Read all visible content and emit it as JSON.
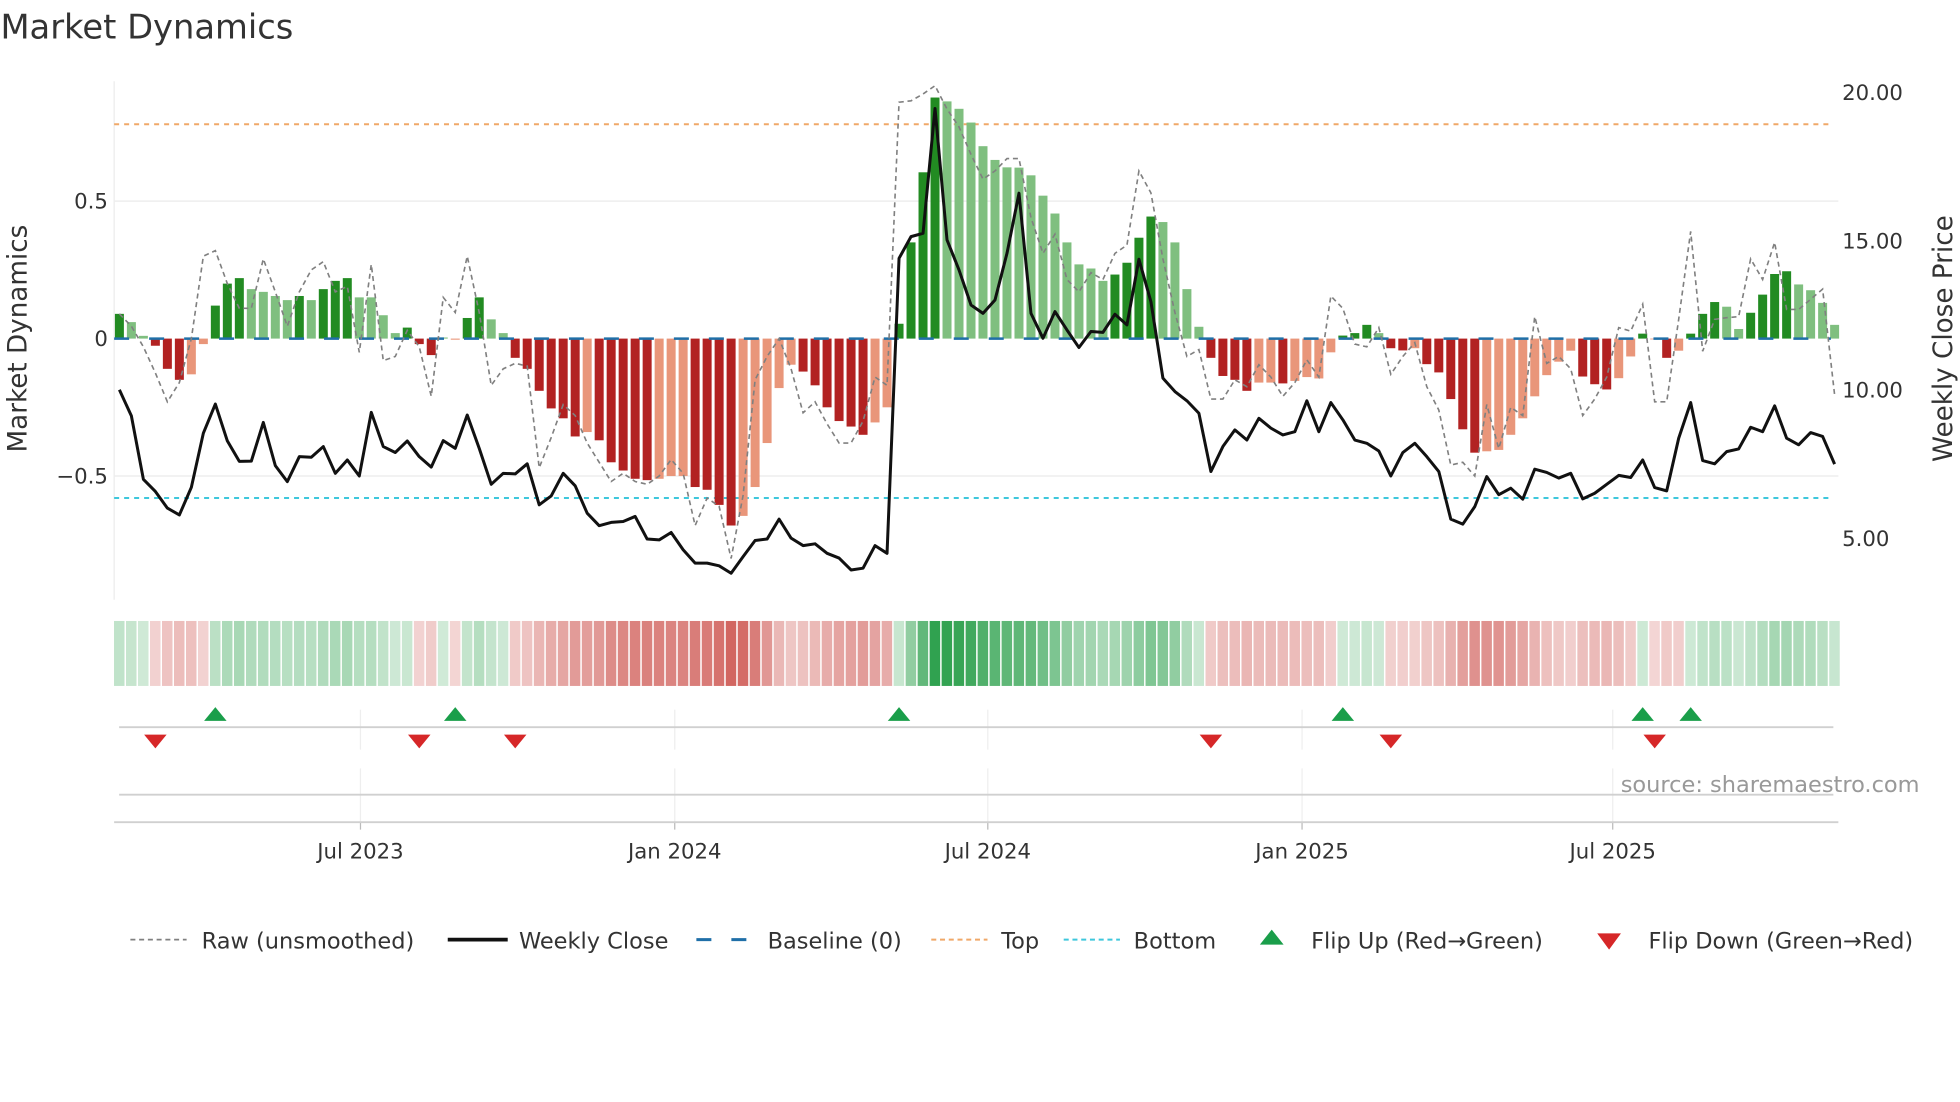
{
  "chart_data": {
    "type": "bar",
    "title": "Market Dynamics",
    "ylabel": "Market Dynamics",
    "y2label": "Weekly Close Price",
    "ylim": [
      -0.95,
      0.95
    ],
    "y2lim": [
      2.8,
      20.5
    ],
    "yticks": [
      {
        "v": 0.5,
        "label": "0.5"
      },
      {
        "v": 0,
        "label": "0"
      },
      {
        "v": -0.5,
        "label": "−0.5"
      }
    ],
    "y2ticks": [
      {
        "v": 20,
        "label": "20.00"
      },
      {
        "v": 15,
        "label": "15.00"
      },
      {
        "v": 10,
        "label": "10.00"
      },
      {
        "v": 5,
        "label": "5.00"
      }
    ],
    "xticks": [
      {
        "v": 20.1,
        "label": "Jul 2023"
      },
      {
        "v": 46.3,
        "label": "Jan 2024"
      },
      {
        "v": 72.4,
        "label": "Jul 2024"
      },
      {
        "v": 98.6,
        "label": "Jan 2025"
      },
      {
        "v": 124.5,
        "label": "Jul 2025"
      }
    ],
    "x_unit": "week index",
    "top_level": 0.78,
    "bottom_level": -0.58,
    "baseline": 0,
    "smoothed": [
      0.09,
      0.06,
      0.01,
      -0.026,
      -0.11,
      -0.15,
      -0.13,
      -0.02,
      0.12,
      0.2,
      0.22,
      0.18,
      0.17,
      0.155,
      0.14,
      0.155,
      0.14,
      0.18,
      0.21,
      0.22,
      0.15,
      0.15,
      0.085,
      0.02,
      0.04,
      -0.02,
      -0.06,
      0.004,
      -0.004,
      0.075,
      0.15,
      0.07,
      0.02,
      -0.07,
      -0.11,
      -0.19,
      -0.254,
      -0.29,
      -0.356,
      -0.34,
      -0.37,
      -0.45,
      -0.48,
      -0.51,
      -0.515,
      -0.51,
      -0.5,
      -0.5,
      -0.54,
      -0.55,
      -0.605,
      -0.68,
      -0.645,
      -0.54,
      -0.38,
      -0.18,
      -0.095,
      -0.12,
      -0.17,
      -0.25,
      -0.3,
      -0.32,
      -0.35,
      -0.305,
      -0.25,
      0.054,
      0.35,
      0.605,
      0.877,
      0.863,
      0.836,
      0.786,
      0.7,
      0.65,
      0.623,
      0.622,
      0.594,
      0.52,
      0.455,
      0.35,
      0.27,
      0.255,
      0.21,
      0.233,
      0.276,
      0.367,
      0.444,
      0.424,
      0.35,
      0.18,
      0.043,
      -0.07,
      -0.136,
      -0.15,
      -0.19,
      -0.16,
      -0.16,
      -0.163,
      -0.154,
      -0.14,
      -0.145,
      -0.05,
      0.011,
      0.02,
      0.05,
      0.02,
      -0.035,
      -0.043,
      -0.035,
      -0.093,
      -0.123,
      -0.22,
      -0.33,
      -0.415,
      -0.41,
      -0.405,
      -0.35,
      -0.29,
      -0.21,
      -0.133,
      -0.084,
      -0.044,
      -0.138,
      -0.166,
      -0.185,
      -0.144,
      -0.065,
      0.018,
      -0.003,
      -0.07,
      -0.044,
      0.018,
      0.09,
      0.133,
      0.116,
      0.035,
      0.094,
      0.16,
      0.235,
      0.245,
      0.197,
      0.176,
      0.13,
      0.05
    ],
    "strong": [
      1,
      0,
      0,
      1,
      1,
      1,
      0,
      0,
      1,
      1,
      1,
      0,
      0,
      0,
      0,
      1,
      0,
      1,
      1,
      1,
      0,
      0,
      0,
      0,
      1,
      1,
      1,
      0,
      0,
      1,
      1,
      0,
      0,
      1,
      1,
      1,
      1,
      1,
      1,
      0,
      1,
      1,
      1,
      1,
      1,
      0,
      0,
      0,
      1,
      1,
      1,
      1,
      0,
      0,
      0,
      0,
      0,
      1,
      1,
      1,
      1,
      1,
      1,
      0,
      0,
      1,
      1,
      1,
      1,
      0,
      0,
      0,
      0,
      0,
      0,
      0,
      0,
      0,
      0,
      0,
      0,
      0,
      0,
      1,
      1,
      1,
      1,
      0,
      0,
      0,
      0,
      1,
      1,
      1,
      1,
      0,
      0,
      1,
      0,
      0,
      0,
      0,
      1,
      1,
      1,
      0,
      1,
      1,
      0,
      1,
      1,
      1,
      1,
      1,
      0,
      0,
      0,
      0,
      0,
      0,
      0,
      0,
      1,
      1,
      1,
      0,
      0,
      1,
      0,
      1,
      0,
      1,
      1,
      1,
      0,
      0,
      1,
      1,
      1,
      1,
      0,
      0,
      0,
      0
    ],
    "raw": [
      0.09,
      0.045,
      -0.03,
      -0.125,
      -0.23,
      -0.16,
      0,
      0.3,
      0.32,
      0.2,
      0.11,
      0.11,
      0.29,
      0.17,
      0.045,
      0.17,
      0.25,
      0.28,
      0.17,
      0.19,
      -0.05,
      0.27,
      -0.08,
      -0.065,
      0.03,
      -0.03,
      -0.21,
      0.15,
      0.095,
      0.3,
      0.095,
      -0.17,
      -0.11,
      -0.09,
      -0.1,
      -0.47,
      -0.36,
      -0.24,
      -0.28,
      -0.38,
      -0.45,
      -0.52,
      -0.49,
      -0.52,
      -0.53,
      -0.5,
      -0.44,
      -0.49,
      -0.68,
      -0.58,
      -0.61,
      -0.8,
      -0.57,
      -0.15,
      -0.065,
      0,
      -0.11,
      -0.27,
      -0.23,
      -0.31,
      -0.38,
      -0.38,
      -0.3,
      -0.14,
      -0.17,
      0.86,
      0.865,
      0.89,
      0.92,
      0.835,
      0.77,
      0.67,
      0.58,
      0.61,
      0.655,
      0.655,
      0.44,
      0.31,
      0.38,
      0.215,
      0.17,
      0.24,
      0.215,
      0.31,
      0.34,
      0.61,
      0.53,
      0.29,
      0.095,
      -0.065,
      -0.04,
      -0.22,
      -0.22,
      -0.15,
      -0.175,
      -0.095,
      -0.14,
      -0.21,
      -0.16,
      -0.077,
      -0.14,
      0.155,
      0.11,
      -0.02,
      -0.03,
      0.04,
      -0.13,
      -0.065,
      -0.015,
      -0.175,
      -0.26,
      -0.46,
      -0.45,
      -0.5,
      -0.24,
      -0.4,
      -0.25,
      -0.28,
      0.08,
      -0.09,
      -0.065,
      -0.11,
      -0.28,
      -0.22,
      -0.14,
      0.04,
      0.027,
      0.125,
      -0.23,
      -0.23,
      0.07,
      0.39,
      -0.046,
      0.07,
      0.076,
      0.08,
      0.29,
      0.215,
      0.35,
      0.106,
      0.106,
      0.143,
      0.18,
      -0.205
    ],
    "close": [
      9.96,
      9.08,
      6.95,
      6.54,
      5.98,
      5.75,
      6.68,
      8.5,
      9.48,
      8.24,
      7.55,
      7.56,
      8.86,
      7.41,
      6.87,
      7.71,
      7.69,
      8.05,
      7.15,
      7.6,
      7.06,
      9.2,
      8.05,
      7.85,
      8.24,
      7.71,
      7.36,
      8.25,
      7.99,
      9.11,
      7.99,
      6.78,
      7.15,
      7.13,
      7.47,
      6.09,
      6.39,
      7.15,
      6.73,
      5.81,
      5.39,
      5.5,
      5.53,
      5.7,
      4.94,
      4.91,
      5.16,
      4.58,
      4.13,
      4.13,
      4.04,
      3.79,
      4.35,
      4.89,
      4.94,
      5.61,
      4.97,
      4.72,
      4.78,
      4.46,
      4.3,
      3.9,
      3.96,
      4.72,
      4.46,
      14.38,
      15.11,
      15.22,
      19.42,
      15.0,
      13.99,
      12.81,
      12.53,
      12.98,
      14.55,
      16.57,
      12.53,
      11.69,
      12.59,
      11.97,
      11.38,
      11.92,
      11.89,
      12.5,
      12.14,
      14.35,
      12.92,
      10.35,
      9.9,
      9.59,
      9.17,
      7.21,
      8.05,
      8.61,
      8.27,
      9.0,
      8.67,
      8.44,
      8.55,
      9.59,
      8.55,
      9.53,
      8.95,
      8.27,
      8.16,
      7.9,
      7.06,
      7.85,
      8.16,
      7.71,
      7.21,
      5.61,
      5.44,
      6.03,
      7.04,
      6.43,
      6.65,
      6.28,
      7.29,
      7.18,
      6.99,
      7.15,
      6.29,
      6.48,
      6.78,
      7.08,
      7.01,
      7.6,
      6.67,
      6.56,
      8.33,
      9.53,
      7.58,
      7.47,
      7.88,
      7.97,
      8.7,
      8.55,
      9.42,
      8.33,
      8.11,
      8.52,
      8.39,
      7.46
    ],
    "flip_up": [
      8,
      28,
      65,
      102,
      127,
      131
    ],
    "flip_down": [
      3,
      25,
      33,
      91,
      106,
      128
    ],
    "legend": {
      "placement": "bottom",
      "items": [
        {
          "key": "raw",
          "label": "Raw (unsmoothed)"
        },
        {
          "key": "close",
          "label": "Weekly Close"
        },
        {
          "key": "baseline",
          "label": "Baseline (0)"
        },
        {
          "key": "top",
          "label": "Top"
        },
        {
          "key": "bottom",
          "label": "Bottom"
        },
        {
          "key": "flip_up",
          "label": "Flip Up (Red→Green)"
        },
        {
          "key": "flip_down",
          "label": "Flip Down (Green→Red)"
        }
      ]
    },
    "source": "source: sharemaestro.com",
    "colors": {
      "strong_pos": "#228b22",
      "weak_pos": "#7fbf7f",
      "strong_neg": "#b22222",
      "weak_neg": "#e9967a",
      "raw": "#808080",
      "close": "#111111",
      "baseline": "#1f6fa8",
      "top": "#f0a868",
      "bottom": "#3ec7dc",
      "up": "#1a9e4a",
      "down": "#d62728"
    }
  }
}
